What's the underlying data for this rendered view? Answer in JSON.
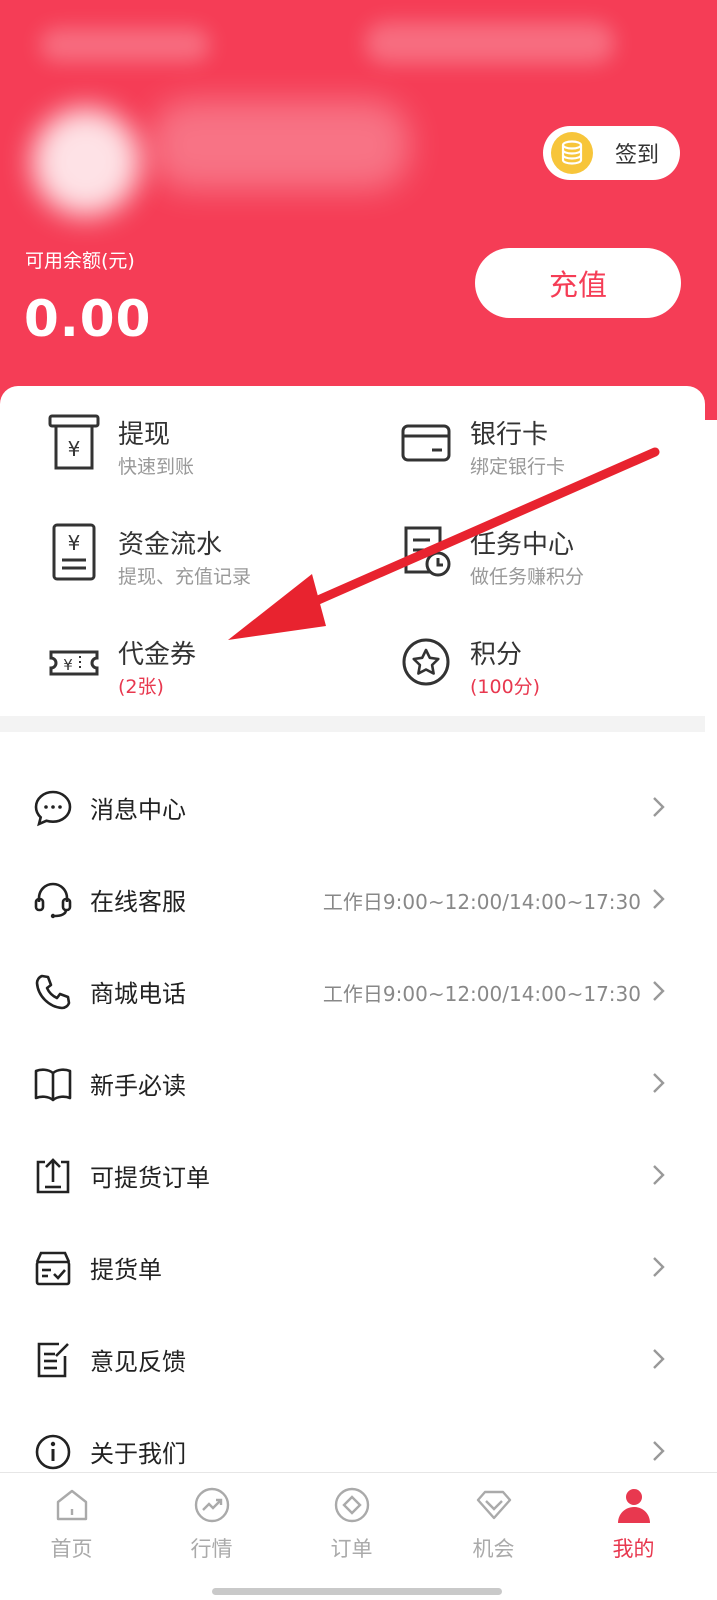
{
  "header": {
    "signin_label": "签到",
    "balance_label": "可用余额(元)",
    "balance_value": "0.00",
    "recharge_label": "充值",
    "bg_color": "#f53d56"
  },
  "grid": [
    {
      "title": "提现",
      "sub": "快速到账",
      "icon": "withdraw-icon"
    },
    {
      "title": "银行卡",
      "sub": "绑定银行卡",
      "icon": "bank-card-icon"
    },
    {
      "title": "资金流水",
      "sub": "提现、充值记录",
      "icon": "ledger-icon"
    },
    {
      "title": "任务中心",
      "sub": "做任务赚积分",
      "icon": "task-clock-icon"
    },
    {
      "title": "代金券",
      "sub": "(2张)",
      "icon": "coupon-icon"
    },
    {
      "title": "积分",
      "sub": "(100分)",
      "icon": "star-icon"
    }
  ],
  "list": [
    {
      "label": "消息中心",
      "right": "",
      "icon": "message-icon"
    },
    {
      "label": "在线客服",
      "right": "工作日9:00~12:00/14:00~17:30",
      "icon": "headset-icon"
    },
    {
      "label": "商城电话",
      "right": "工作日9:00~12:00/14:00~17:30",
      "icon": "phone-icon"
    },
    {
      "label": "新手必读",
      "right": "",
      "icon": "book-icon"
    },
    {
      "label": "可提货订单",
      "right": "",
      "icon": "upload-box-icon"
    },
    {
      "label": "提货单",
      "right": "",
      "icon": "delivery-box-icon"
    },
    {
      "label": "意见反馈",
      "right": "",
      "icon": "feedback-icon"
    },
    {
      "label": "关于我们",
      "right": "",
      "icon": "info-icon"
    }
  ],
  "tabs": [
    {
      "label": "首页",
      "icon": "home-icon"
    },
    {
      "label": "行情",
      "icon": "trend-icon"
    },
    {
      "label": "订单",
      "icon": "order-icon"
    },
    {
      "label": "机会",
      "icon": "gem-icon"
    },
    {
      "label": "我的",
      "icon": "profile-icon",
      "active": true
    }
  ],
  "colors": {
    "accent": "#e8384f",
    "header": "#f53d56",
    "arrow": "#e8232f"
  }
}
